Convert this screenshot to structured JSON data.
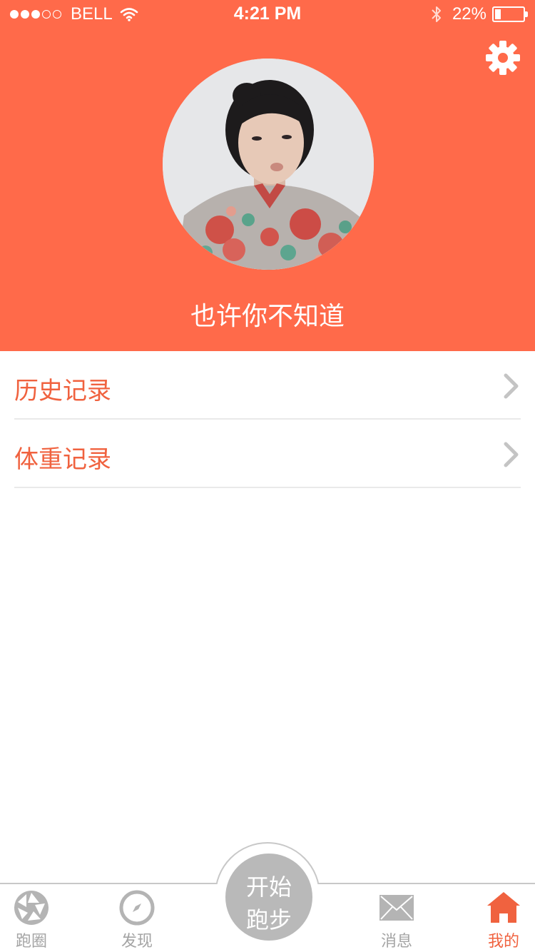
{
  "status_bar": {
    "signal_filled": 3,
    "signal_total": 5,
    "carrier": "BELL",
    "time": "4:21 PM",
    "battery_text": "22%",
    "battery_level": 0.22
  },
  "profile": {
    "username": "也许你不知道",
    "avatar_icon": "avatar-photo",
    "settings_icon": "gear-icon"
  },
  "menu": {
    "items": [
      {
        "label": "历史记录",
        "icon": "chevron-right-icon"
      },
      {
        "label": "体重记录",
        "icon": "chevron-right-icon"
      }
    ]
  },
  "tabbar": {
    "items": [
      {
        "label": "跑圈",
        "icon": "aperture-icon",
        "active": false
      },
      {
        "label": "发现",
        "icon": "compass-icon",
        "active": false
      },
      {
        "label": "消息",
        "icon": "envelope-icon",
        "active": false
      },
      {
        "label": "我的",
        "icon": "home-icon",
        "active": true
      }
    ],
    "center_button": {
      "line1": "开始",
      "line2": "跑步"
    }
  },
  "colors": {
    "brand": "#FF6A4A",
    "accent_text": "#F0623F",
    "inactive_icon": "#B4B4B4",
    "divider": "#E9E9E9"
  }
}
